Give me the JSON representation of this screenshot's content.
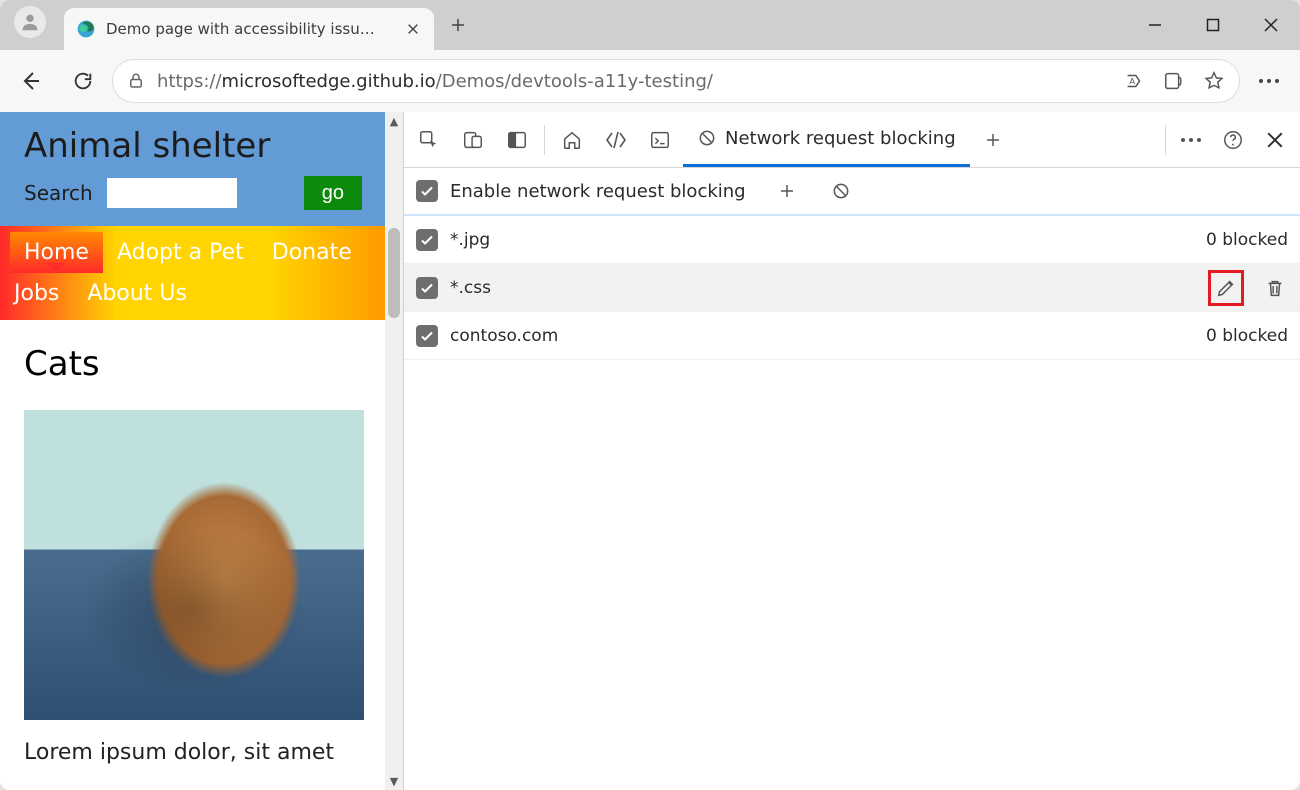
{
  "browser": {
    "tab_title": "Demo page with accessibility issu…",
    "url_host": "microsoftedge.github.io",
    "url_scheme": "https://",
    "url_path": "/Demos/devtools-a11y-testing/"
  },
  "page": {
    "site_title": "Animal shelter",
    "search_label": "Search",
    "go_label": "go",
    "nav": [
      "Home",
      "Adopt a Pet",
      "Donate",
      "Jobs",
      "About Us"
    ],
    "heading": "Cats",
    "paragraph": "Lorem ipsum dolor, sit amet"
  },
  "devtools": {
    "active_panel": "Network request blocking",
    "enable_label": "Enable network request blocking",
    "patterns": [
      {
        "pattern": "*.jpg",
        "count_label": "0 blocked",
        "hover": false,
        "show_actions": false
      },
      {
        "pattern": "*.css",
        "count_label": "",
        "hover": true,
        "show_actions": true
      },
      {
        "pattern": "contoso.com",
        "count_label": "0 blocked",
        "hover": false,
        "show_actions": false
      }
    ]
  }
}
